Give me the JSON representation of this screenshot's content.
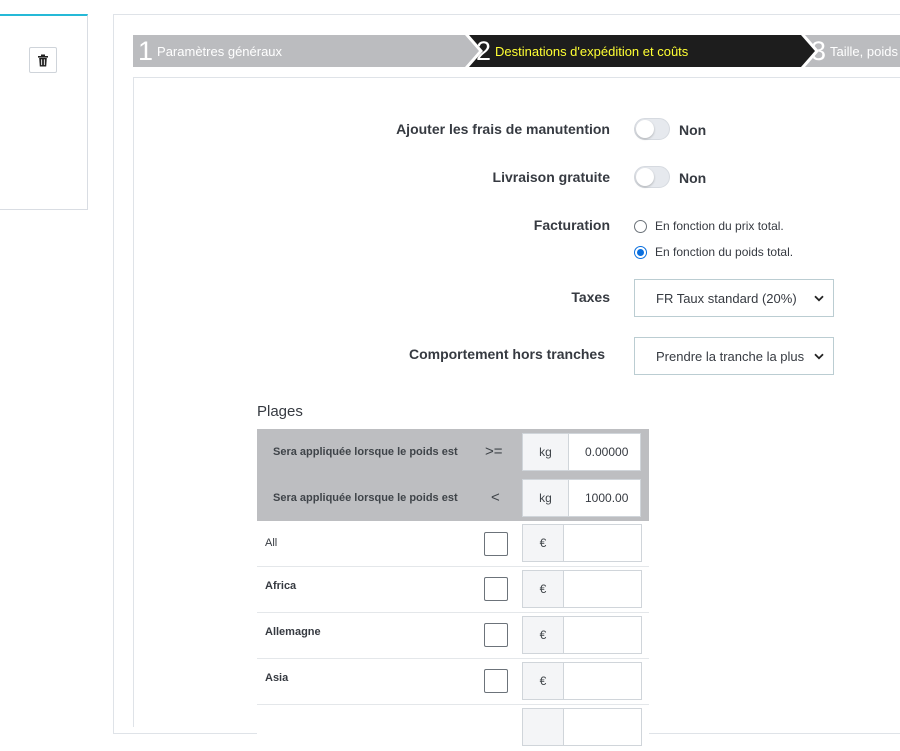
{
  "steps": [
    {
      "num": "1",
      "label": "Paramètres généraux"
    },
    {
      "num": "2",
      "label": "Destinations d'expédition et coûts"
    },
    {
      "num": "3",
      "label": "Taille, poids"
    }
  ],
  "form": {
    "handling": {
      "label": "Ajouter les frais de manutention",
      "state": "Non"
    },
    "free_shipping": {
      "label": "Livraison gratuite",
      "state": "Non"
    },
    "billing": {
      "label": "Facturation",
      "options": [
        "En fonction du prix total.",
        "En fonction du poids total."
      ],
      "selected_index": 1
    },
    "taxes": {
      "label": "Taxes",
      "value": "FR Taux standard (20%)"
    },
    "out_of_range": {
      "label": "Comportement hors tranches",
      "value": "Prendre la tranche la plus"
    }
  },
  "ranges": {
    "title": "Plages",
    "rows": [
      {
        "label": "Sera appliquée lorsque le poids est",
        "operator": ">=",
        "unit": "kg",
        "value": "0.00000"
      },
      {
        "label": "Sera appliquée lorsque le poids est",
        "operator": "<",
        "unit": "kg",
        "value": "1000.00"
      }
    ],
    "currency": "€",
    "zones": [
      {
        "name": "All",
        "bold": false
      },
      {
        "name": "Africa",
        "bold": true
      },
      {
        "name": "Allemagne",
        "bold": true
      },
      {
        "name": "Asia",
        "bold": true
      }
    ]
  },
  "colors": {
    "accent": "#25b9d7",
    "active_step_bg": "#1d1d1d",
    "active_step_text": "#ffff33",
    "inactive_step_bg": "#bbbcbf",
    "radio_checked": "#0a6fde"
  },
  "icons": {
    "delete": "trash-icon",
    "select": "chevron-down-icon"
  }
}
